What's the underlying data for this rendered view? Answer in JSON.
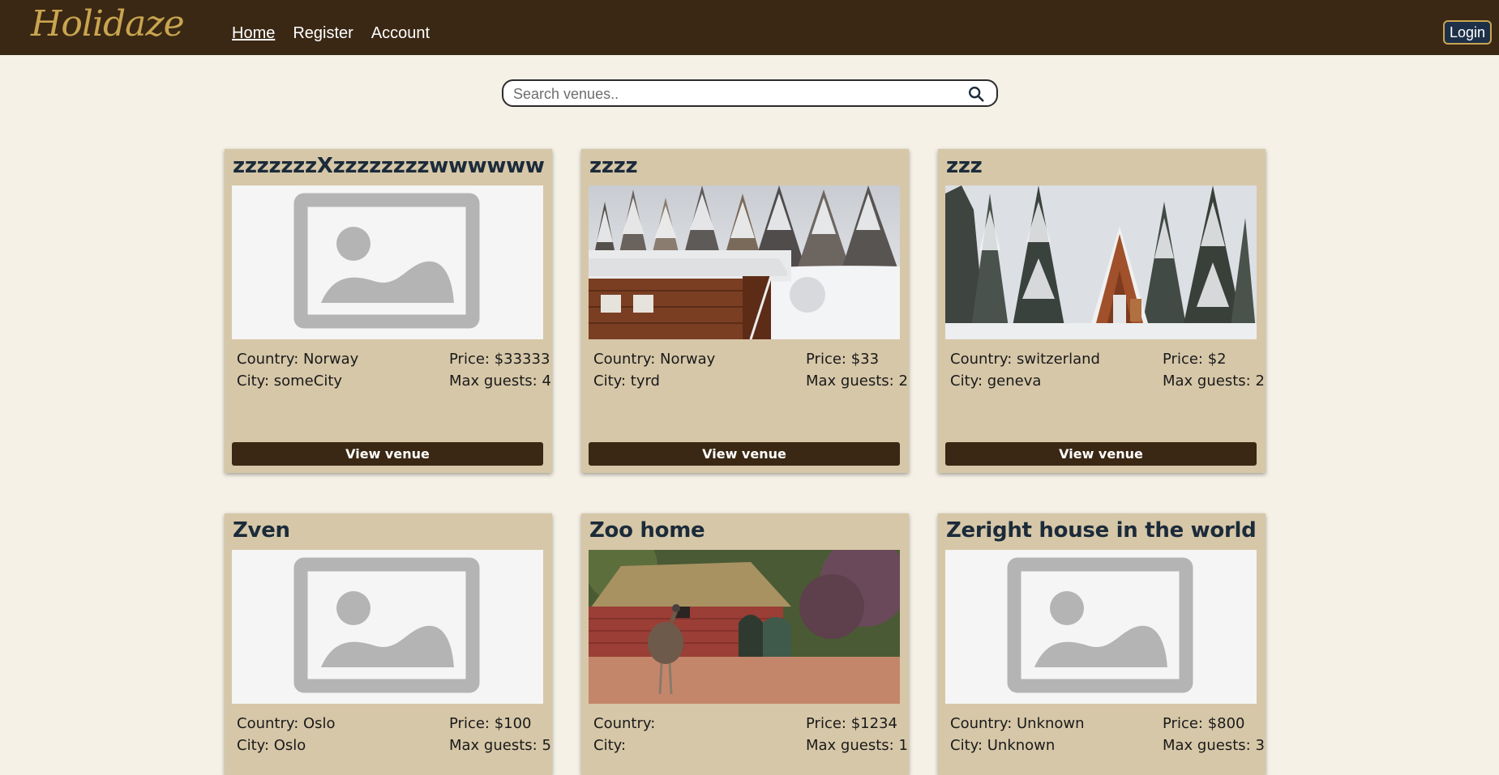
{
  "header": {
    "logo": "Holidaze",
    "nav": [
      {
        "label": "Home",
        "active": true
      },
      {
        "label": "Register",
        "active": false
      },
      {
        "label": "Account",
        "active": false
      }
    ],
    "login_label": "Login"
  },
  "search": {
    "placeholder": "Search venues..",
    "value": ""
  },
  "colors": {
    "navbar": "#3a2814",
    "page_background": "#f5f1e6",
    "card_background": "#d6c7a8",
    "accent_gold": "#c9a550",
    "title_text": "#1c2b3a",
    "button": "#3a2814"
  },
  "venues": [
    {
      "name": "zzzzzzzXzzzzzzzzwwwwww",
      "image": "placeholder-icon",
      "country": "Country: Norway",
      "city": "City: someCity",
      "price": "Price: $33333",
      "guests": "Max guests: 4",
      "button": "View venue"
    },
    {
      "name": "zzzz",
      "image": "snowy-cabin-photo",
      "country": "Country: Norway",
      "city": "City: tyrd",
      "price": "Price: $33",
      "guests": "Max guests: 2",
      "button": "View venue"
    },
    {
      "name": "zzz",
      "image": "a-frame-cabin-photo",
      "country": "Country: switzerland",
      "city": "City: geneva",
      "price": "Price: $2",
      "guests": "Max guests: 2",
      "button": "View venue"
    },
    {
      "name": "Zven",
      "image": "placeholder-icon",
      "country": "Country: Oslo",
      "city": "City: Oslo",
      "price": "Price: $100",
      "guests": "Max guests: 5",
      "button": "View venue"
    },
    {
      "name": "Zoo home",
      "image": "emu-hut-photo",
      "country": "Country:",
      "city": "City:",
      "price": "Price: $1234",
      "guests": "Max guests: 1",
      "button": "View venue"
    },
    {
      "name": "Zeright house in the world",
      "image": "placeholder-icon",
      "country": "Country: Unknown",
      "city": "City: Unknown",
      "price": "Price: $800",
      "guests": "Max guests: 3",
      "button": "View venue"
    }
  ]
}
